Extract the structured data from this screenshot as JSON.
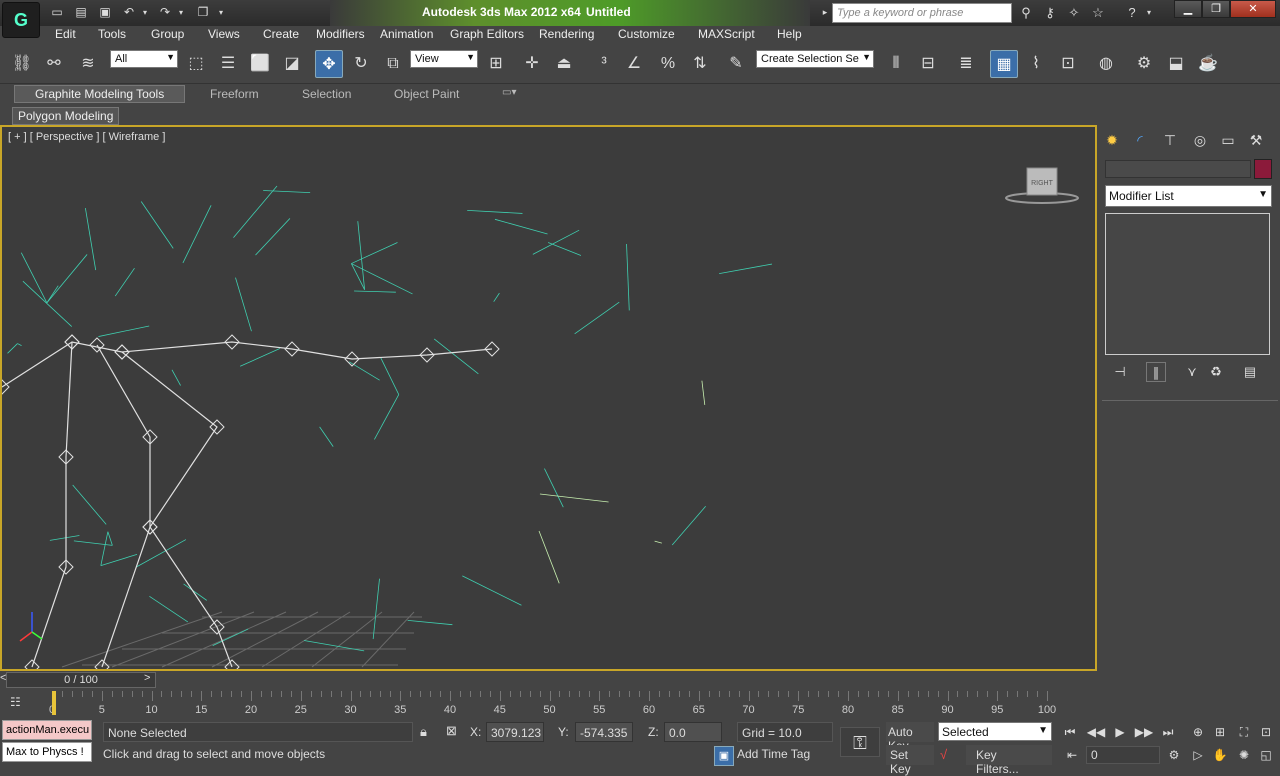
{
  "titlebar": {
    "app_title": "Autodesk 3ds Max  2012 x64",
    "document": "Untitled",
    "search_placeholder": "Type a keyword or phrase",
    "logo": "G"
  },
  "menu": [
    "Edit",
    "Tools",
    "Group",
    "Views",
    "Create",
    "Modifiers",
    "Animation",
    "Graph Editors",
    "Rendering",
    "Customize",
    "MAXScript",
    "Help"
  ],
  "toolbar": {
    "selection_filter": "All",
    "ref_coord": "View",
    "named_selection": "Create Selection Se"
  },
  "ribbon": {
    "tabs": [
      "Graphite Modeling Tools",
      "Freeform",
      "Selection",
      "Object Paint"
    ],
    "panel": "Polygon Modeling"
  },
  "viewport": {
    "label": "[ + ] [ Perspective ] [ Wireframe ]",
    "viewcube_face": "RIGHT"
  },
  "command_panel": {
    "modifier_list": "Modifier List",
    "color_swatch": "#8b1a3a"
  },
  "timeline": {
    "slider": "0 / 100",
    "left_arrow": "<",
    "right_arrow": ">",
    "ticks": [
      "0",
      "5",
      "10",
      "15",
      "20",
      "25",
      "30",
      "35",
      "40",
      "45",
      "50",
      "55",
      "60",
      "65",
      "70",
      "75",
      "80",
      "85",
      "90",
      "95",
      "100"
    ]
  },
  "status": {
    "maxscript_top": "actionMan.execu",
    "maxscript_bottom": "Max to Physcs !",
    "selection": "None Selected",
    "prompt": "Click and drag to select and move objects",
    "x_label": "X:",
    "x_value": "3079.123",
    "y_label": "Y:",
    "y_value": "-574.335",
    "z_label": "Z:",
    "z_value": "0.0",
    "grid": "Grid = 10.0",
    "add_time_tag": "Add Time Tag",
    "auto_key": "Auto Key",
    "set_key": "Set Key",
    "key_mode": "Selected",
    "key_filters": "Key Filters...",
    "current_frame": "0"
  },
  "colors": {
    "wire": "#3fcfb0",
    "wire_light": "#c8f0b0",
    "viewport_border": "#c8a628",
    "bone": "#e0e0e0"
  }
}
